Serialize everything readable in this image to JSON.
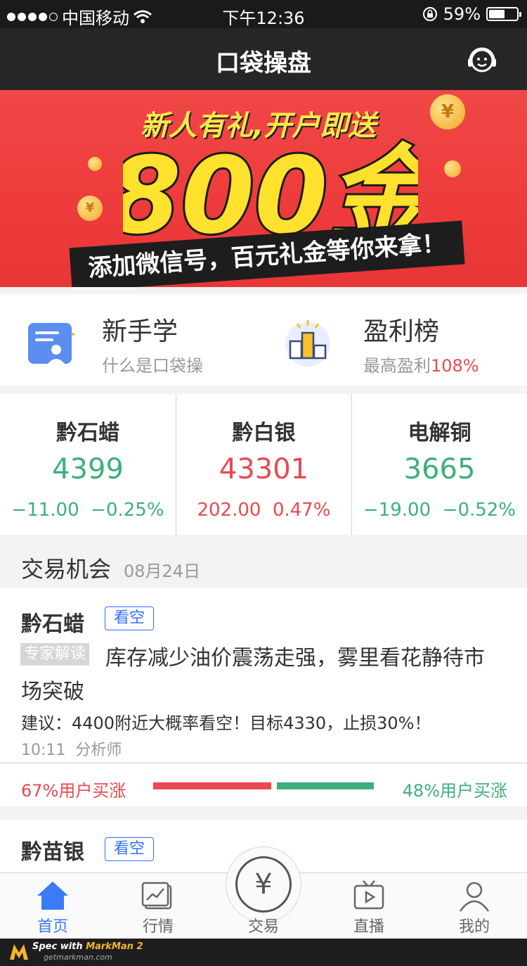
{
  "status_bar": {
    "carrier": "中国移动",
    "time": "下午12:36",
    "battery": "59%",
    "battery_level": 0.59
  },
  "nav": {
    "title": "口袋操盘",
    "service_icon": "customer-service-icon"
  },
  "banner": {
    "headline": "新人有礼,开户即送",
    "amount": "800金",
    "subline": "添加微信号，百元礼金等你来拿！"
  },
  "features": [
    {
      "title": "新手学",
      "subtitle": "什么是口袋操",
      "icon": "document-user-icon"
    },
    {
      "title": "盈利榜",
      "subtitle_prefix": "最高盈利",
      "subtitle_value": "108%",
      "icon": "podium-icon"
    }
  ],
  "markets": [
    {
      "name": "黔石蜡",
      "price": "4399",
      "change": "−11.00",
      "change_pct": "−0.25%",
      "trend": "down"
    },
    {
      "name": "黔白银",
      "price": "43301",
      "change": "202.00",
      "change_pct": "0.47%",
      "trend": "up"
    },
    {
      "name": "电解铜",
      "price": "3665",
      "change": "−19.00",
      "change_pct": "−0.52%",
      "trend": "down"
    }
  ],
  "opportunity": {
    "title": "交易机会",
    "date": "08月24日"
  },
  "card": {
    "name": "黔石蜡",
    "tag": "看空",
    "expert_label": "专家解读",
    "headline_line1": "库存减少油价震荡走强，雾里看花静待市",
    "headline_line2": "场突破",
    "advice": "建议：4400附近大概率看空！目标4330，止损30%！",
    "time": "10:11",
    "author": "分析师",
    "bear_text": "67%用户买涨",
    "bull_text": "48%用户买涨",
    "bear_share": 0.67,
    "bull_share": 0.48
  },
  "card2": {
    "name": "黔苗银",
    "tag": "看空"
  },
  "tabbar": [
    {
      "label": "首页",
      "icon": "home-icon",
      "active": true
    },
    {
      "label": "行情",
      "icon": "chart-icon",
      "active": false
    },
    {
      "label": "交易",
      "icon": "yuan-icon",
      "active": false
    },
    {
      "label": "直播",
      "icon": "tv-play-icon",
      "active": false
    },
    {
      "label": "我的",
      "icon": "user-icon",
      "active": false
    }
  ],
  "footer": {
    "brand_prefix": "Spec with ",
    "brand": "MarkMan 2",
    "url": "getmarkman.com"
  },
  "colors": {
    "text_primary": "#333333",
    "text_secondary": "#999999",
    "red": "#ea4950",
    "green": "#3cb07b",
    "blue": "#336fff",
    "divider": "#d0d0d0",
    "background": "#f3f3f3"
  }
}
